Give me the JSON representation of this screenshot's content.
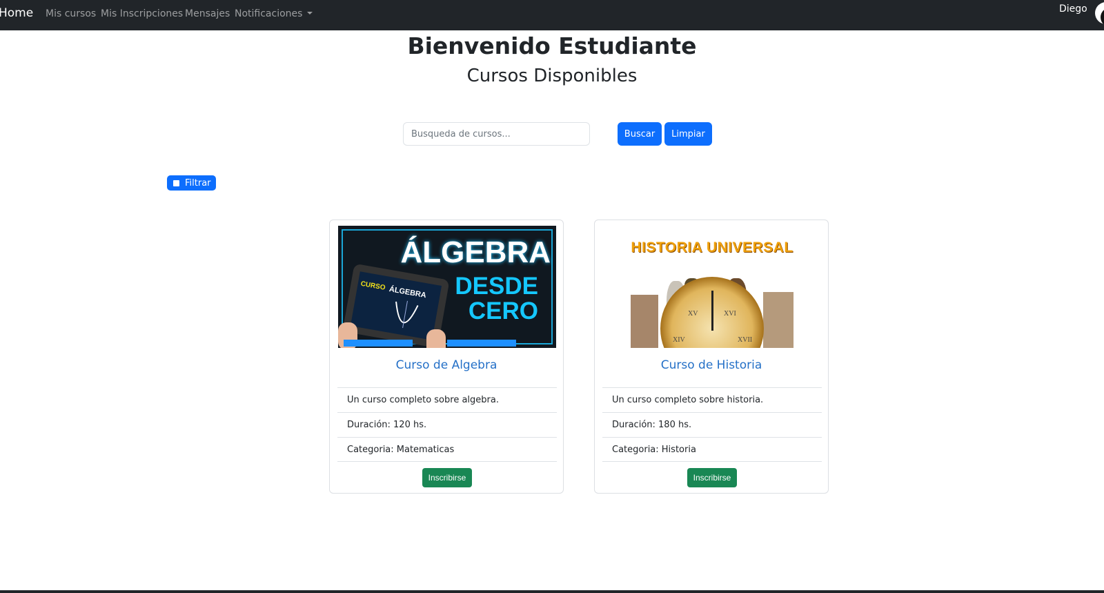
{
  "navbar": {
    "brand": "Home",
    "links": [
      "Mis cursos",
      "Mis Inscripciones",
      "Mensajes",
      "Notificaciones"
    ],
    "user": "Diego"
  },
  "header": {
    "title": "Bienvenido Estudiante",
    "subtitle": "Cursos Disponibles"
  },
  "search": {
    "placeholder": "Busqueda de cursos...",
    "value": "",
    "search_button": "Buscar",
    "clear_button": "Limpiar"
  },
  "filter": {
    "label": "Filtrar",
    "checked": false
  },
  "courses": [
    {
      "title": "Curso de Algebra",
      "description": "Un curso completo sobre algebra.",
      "duration": "Duración: 120 hs.",
      "category": "Categoria: Matematicas",
      "button": "Inscribirse",
      "image_text": {
        "line1": "ÁLGEBRA",
        "line2": "DESDE",
        "line3": "CERO",
        "tab_curso": "CURSO",
        "tab_alg": "ÁLGEBRA"
      }
    },
    {
      "title": "Curso de Historia",
      "description": "Un curso completo sobre historia.",
      "duration": "Duración: 180 hs.",
      "category": "Categoria: Historia",
      "button": "Inscribirse",
      "image_text": {
        "title": "HISTORIA UNIVERSAL",
        "xv": "XV",
        "xvi": "XVI",
        "xiv": "XIV",
        "xvii": "XVII"
      }
    }
  ],
  "colors": {
    "navbar_bg": "#212529",
    "primary": "#0d6efd",
    "success": "#198754",
    "card_title": "#2470c7"
  }
}
